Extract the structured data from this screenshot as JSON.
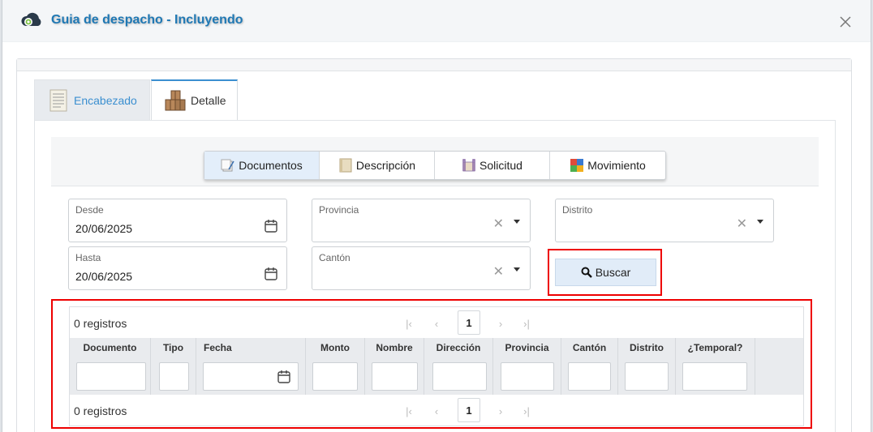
{
  "dialog": {
    "title": "Guia de despacho - Incluyendo"
  },
  "tabs": [
    {
      "label": "Encabezado"
    },
    {
      "label": "Detalle"
    }
  ],
  "subtabs": [
    {
      "label": "Documentos"
    },
    {
      "label": "Descripción"
    },
    {
      "label": "Solicitud"
    },
    {
      "label": "Movimiento"
    }
  ],
  "filters": {
    "desde": {
      "label": "Desde",
      "value": "20/06/2025"
    },
    "hasta": {
      "label": "Hasta",
      "value": "20/06/2025"
    },
    "provincia": {
      "label": "Provincia",
      "value": ""
    },
    "canton": {
      "label": "Cantón",
      "value": ""
    },
    "distrito": {
      "label": "Distrito",
      "value": ""
    }
  },
  "buscar_label": "Buscar",
  "grid": {
    "count_top": "0 registros",
    "count_bottom": "0 registros",
    "page": "1",
    "columns": [
      "Documento",
      "Tipo",
      "Fecha",
      "Monto",
      "Nombre",
      "Dirección",
      "Provincia",
      "Cantón",
      "Distrito",
      "¿Temporal?"
    ]
  },
  "colors": {
    "accent": "#3b8fd0",
    "title": "#1f78b4",
    "highlight": "#ee0000"
  }
}
